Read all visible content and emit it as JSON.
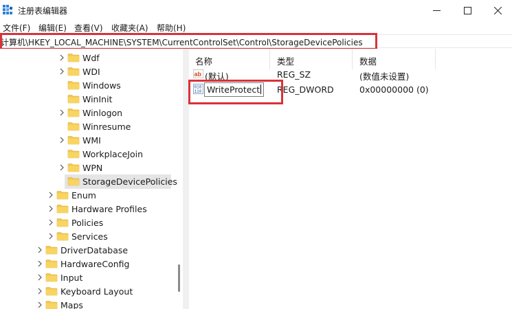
{
  "window": {
    "title": "注册表编辑器"
  },
  "menu": [
    "文件(F)",
    "编辑(E)",
    "查看(V)",
    "收藏夹(A)",
    "帮助(H)"
  ],
  "address": "计算机\\HKEY_LOCAL_MACHINE\\SYSTEM\\CurrentControlSet\\Control\\StorageDevicePolicies",
  "tree": [
    {
      "label": "Wdf",
      "expandable": true
    },
    {
      "label": "WDI",
      "expandable": true
    },
    {
      "label": "Windows",
      "expandable": false
    },
    {
      "label": "WinInit",
      "expandable": false
    },
    {
      "label": "Winlogon",
      "expandable": true
    },
    {
      "label": "Winresume",
      "expandable": false
    },
    {
      "label": "WMI",
      "expandable": true
    },
    {
      "label": "WorkplaceJoin",
      "expandable": false
    },
    {
      "label": "WPN",
      "expandable": true
    },
    {
      "label": "StorageDevicePolicies",
      "expandable": false,
      "selected": true
    },
    {
      "label": "Enum",
      "expandable": true
    },
    {
      "label": "Hardware Profiles",
      "expandable": true
    },
    {
      "label": "Policies",
      "expandable": true
    },
    {
      "label": "Services",
      "expandable": true
    },
    {
      "label": "DriverDatabase",
      "expandable": true
    },
    {
      "label": "HardwareConfig",
      "expandable": true
    },
    {
      "label": "Input",
      "expandable": true
    },
    {
      "label": "Keyboard Layout",
      "expandable": true
    },
    {
      "label": "Maps",
      "expandable": true
    }
  ],
  "columns": {
    "name": "名称",
    "type": "类型",
    "data": "数据"
  },
  "values": [
    {
      "name": "(默认)",
      "type": "REG_SZ",
      "data": "(数值未设置)",
      "icon": "string-value-icon"
    },
    {
      "name": "WriteProtect",
      "type": "REG_DWORD",
      "data": "0x00000000 (0)",
      "icon": "binary-value-icon",
      "editing": true
    }
  ],
  "colors": {
    "highlight": "#d8323a",
    "folder": "#f3c74f",
    "selection": "#e5e5e5"
  }
}
